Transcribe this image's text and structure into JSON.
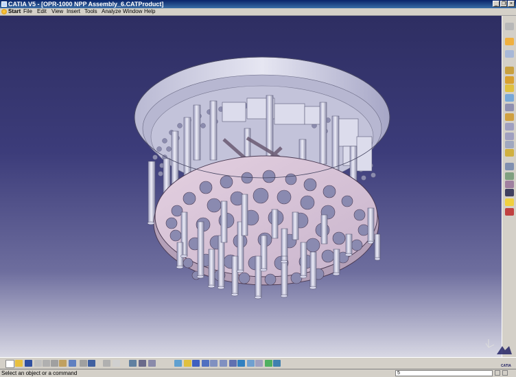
{
  "window": {
    "title": "CATIA V5 - [OPR-1000 NPP Assembly_6.CATProduct]",
    "controls": [
      "minimize",
      "restore",
      "close"
    ]
  },
  "menubar": {
    "items": [
      "Start",
      "File",
      "Edit",
      "View",
      "Insert",
      "Tools",
      "Analyze",
      "Window",
      "Help"
    ]
  },
  "viewport": {
    "background_top": "#2e2e62",
    "background_bottom": "#d8d8e4",
    "model_color": "#c8c8de"
  },
  "right_toolbar": {
    "icons": [
      "sketcher-icon",
      "select-icon",
      "product-icon",
      "component-icon",
      "part-icon",
      "existing-component-icon",
      "replace-icon",
      "graph-tree-icon",
      "generate-numbering-icon",
      "fast-multi-instantiation-icon",
      "constraint-icon",
      "fix-icon",
      "coincidence-icon",
      "contact-icon",
      "offset-icon",
      "angle-icon",
      "manipulation-icon",
      "snap-icon",
      "explode-icon",
      "clash-icon"
    ]
  },
  "bottom_toolbar": {
    "icons": [
      "new-icon",
      "open-icon",
      "save-icon",
      "print-icon",
      "cut-icon",
      "copy-icon",
      "paste-icon",
      "undo-icon",
      "redo-icon",
      "whats-this-icon",
      "formula-icon",
      "comment-icon",
      "catalog-icon",
      "measure-icon",
      "inertia-icon",
      "fly-mode-icon",
      "fit-all-icon",
      "pan-icon",
      "rotate-icon",
      "zoom-in-icon",
      "zoom-out-icon",
      "normal-view-icon",
      "iso-view-icon",
      "quick-view-icon",
      "shading-icon",
      "hide-show-icon",
      "swap-visible-space-icon"
    ]
  },
  "status": {
    "message": "Select an object or a command",
    "command_value": "5"
  },
  "logo": {
    "text": "CATIA"
  }
}
